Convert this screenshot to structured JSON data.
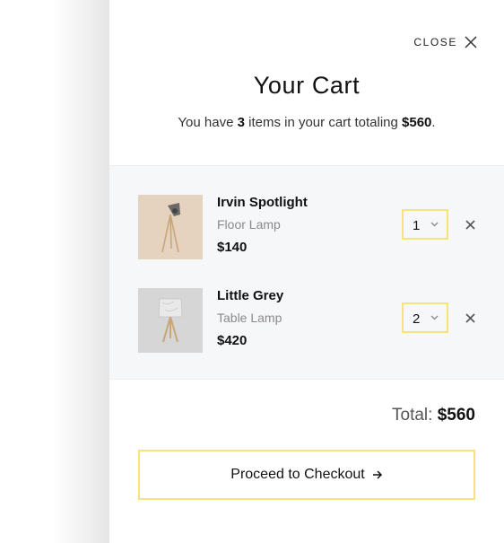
{
  "header": {
    "close_label": "CLOSE",
    "title": "Your Cart",
    "summary_prefix": "You have ",
    "item_count": "3",
    "summary_mid": " items in your cart totaling ",
    "summary_total": "$560",
    "summary_suffix": "."
  },
  "items": [
    {
      "name": "Irvin Spotlight",
      "type": "Floor Lamp",
      "price": "$140",
      "quantity": "1",
      "thumb_icon": "floor-lamp-image",
      "thumb_bg": "#e6d3bf"
    },
    {
      "name": "Little Grey",
      "type": "Table Lamp",
      "price": "$420",
      "quantity": "2",
      "thumb_icon": "table-lamp-image",
      "thumb_bg": "#d6d6d6"
    }
  ],
  "footer": {
    "total_label": "Total: ",
    "total_value": "$560",
    "checkout_label": "Proceed to Checkout"
  },
  "colors": {
    "accent_border": "#f7e37b",
    "items_background": "#f6f7f9",
    "muted_text": "#8a8a8a"
  },
  "icons": {
    "close": "close-icon",
    "remove": "remove-icon",
    "dropdown": "chevron-down-icon",
    "checkout_arrow": "arrow-right-icon"
  }
}
